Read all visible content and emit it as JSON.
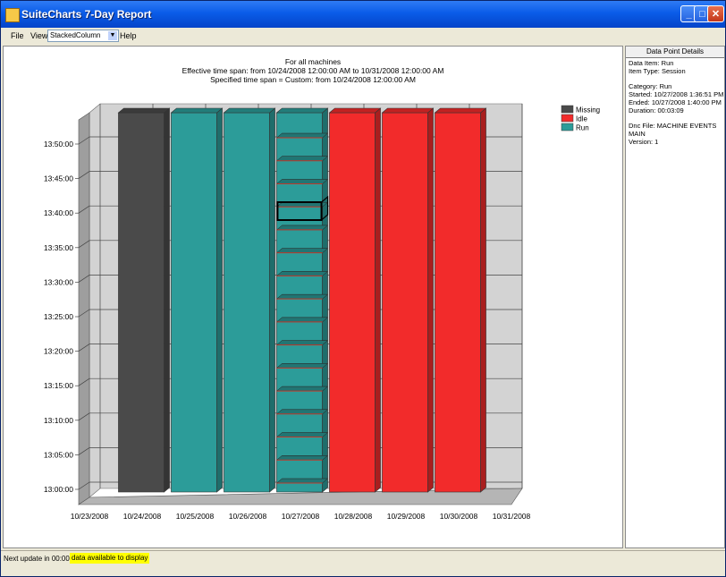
{
  "window": {
    "title": "SuiteCharts 7-Day Report",
    "title_color": "#0a5ce8"
  },
  "menu": {
    "file": "File",
    "view": "View",
    "view_select_value": "StackedColumn",
    "help": "Help"
  },
  "chart": {
    "line1": "For all machines",
    "line2": "Effective time span: from 10/24/2008 12:00:00 AM to 10/31/2008 12:00:00 AM",
    "line3": "Specified time span = Custom: from 10/24/2008 12:00:00 AM"
  },
  "chart_data": {
    "type": "bar",
    "stacked": true,
    "three_d": true,
    "categories": [
      "10/24/2008",
      "10/25/2008",
      "10/26/2008",
      "10/27/2008",
      "10/28/2008",
      "10/29/2008",
      "10/30/2008"
    ],
    "x_ticks": [
      "10/23/2008",
      "10/24/2008",
      "10/25/2008",
      "10/26/2008",
      "10/27/2008",
      "10/28/2008",
      "10/29/2008",
      "10/30/2008",
      "10/31/2008"
    ],
    "y_ticks": [
      "13:00:00",
      "13:05:00",
      "13:10:00",
      "13:15:00",
      "13:20:00",
      "13:25:00",
      "13:30:00",
      "13:35:00",
      "13:40:00",
      "13:45:00",
      "13:50:00"
    ],
    "series": [
      {
        "name": "Missing",
        "color": "#4a4a4a",
        "category_index": 0
      },
      {
        "name": "Idle",
        "color": "#f22b2b",
        "category_index": [
          4,
          5,
          6
        ]
      },
      {
        "name": "Run",
        "color": "#2c9c99",
        "category_index": [
          1,
          2,
          3
        ]
      }
    ],
    "legend": [
      "Missing",
      "Idle",
      "Run"
    ],
    "legend_position": "top-right",
    "grid": true,
    "selected_category": "10/27/2008"
  },
  "details": {
    "header": "Data Point Details",
    "lines": [
      "Data Item: Run",
      "Item Type: Session",
      "",
      "Category: Run",
      "Started: 10/27/2008 1:36:51 PM",
      "Ended: 10/27/2008 1:40:00 PM",
      "Duration: 00:03:09",
      "",
      "Dnc File: MACHINE EVENTS",
      "MAIN",
      "Version: 1"
    ]
  },
  "status": {
    "next_update": "Next update in 00:00:37",
    "message": "data available to display",
    "highlight_color": "#ffff00"
  }
}
